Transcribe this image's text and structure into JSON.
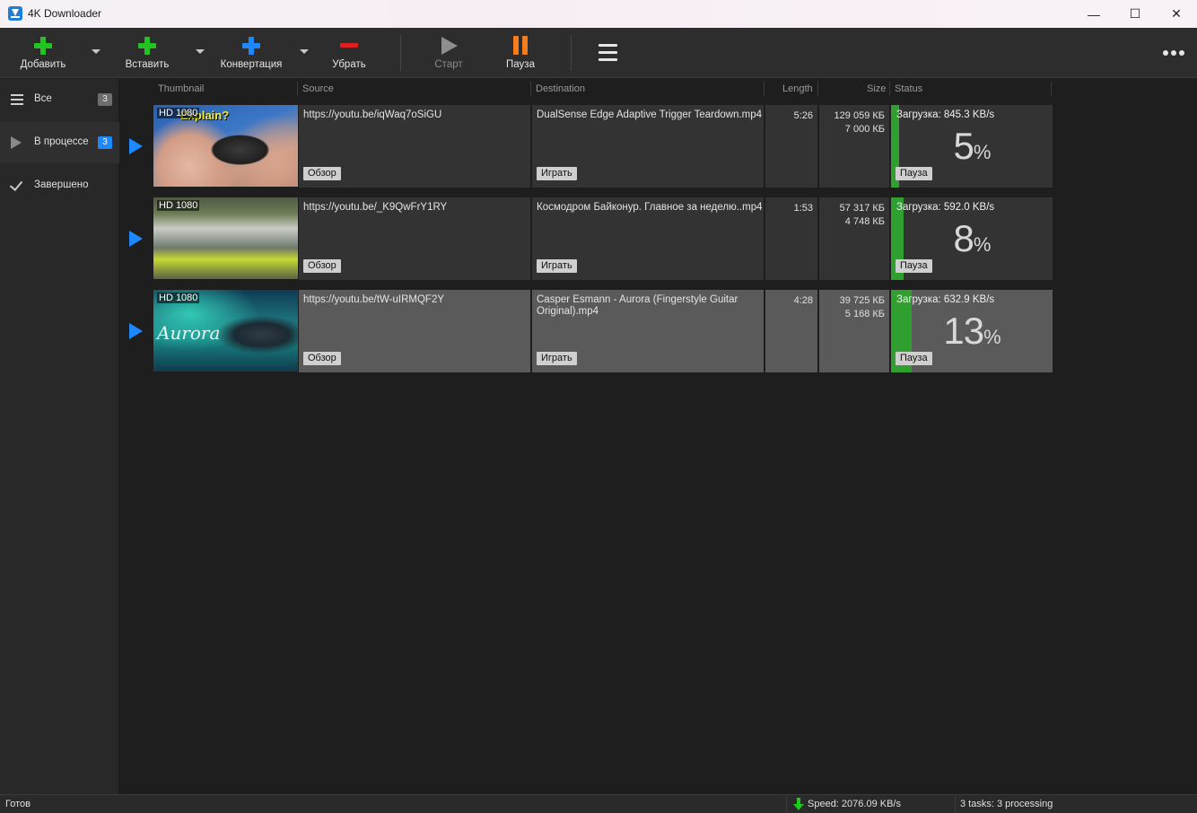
{
  "window": {
    "title": "4K Downloader",
    "minimize_glyph": "—",
    "maximize_glyph": "☐",
    "close_glyph": "✕"
  },
  "toolbar": {
    "add_label": "Добавить",
    "paste_label": "Вставить",
    "convert_label": "Конвертация",
    "remove_label": "Убрать",
    "start_label": "Старт",
    "pause_label": "Пауза",
    "colors": {
      "add": "#22c322",
      "paste": "#22c322",
      "convert": "#1e88ff",
      "remove": "#e02020",
      "pause": "#f57c1f"
    }
  },
  "sidebar": {
    "items": [
      {
        "label": "Все",
        "badge": "3",
        "icon": "list-icon"
      },
      {
        "label": "В процессе",
        "badge": "3",
        "icon": "play-icon"
      },
      {
        "label": "Завершено",
        "badge": "",
        "icon": "check-icon"
      }
    ]
  },
  "columns": {
    "thumbnail": "Thumbnail",
    "source": "Source",
    "destination": "Destination",
    "length": "Length",
    "size": "Size",
    "status": "Status"
  },
  "rows": [
    {
      "quality": "HD 1080",
      "caption": "Explain?",
      "source": "https://youtu.be/iqWaq7oSiGU",
      "browse_label": "Обзор",
      "destination": "DualSense Edge Adaptive Trigger Teardown.mp4",
      "play_label": "Играть",
      "length": "5:26",
      "size_total": "129 059 КБ",
      "size_done": "7 000 КБ",
      "status": "Загрузка: 845.3 KB/s",
      "percent": "5",
      "percent_unit": "%",
      "progress": 0.05,
      "pause_label": "Пауза"
    },
    {
      "quality": "HD 1080",
      "source": "https://youtu.be/_K9QwFrY1RY",
      "browse_label": "Обзор",
      "destination": "Космодром Байконур. Главное за неделю..mp4",
      "play_label": "Играть",
      "length": "1:53",
      "size_total": "57 317 КБ",
      "size_done": "4 748 КБ",
      "status": "Загрузка: 592.0 KB/s",
      "percent": "8",
      "percent_unit": "%",
      "progress": 0.08,
      "pause_label": "Пауза"
    },
    {
      "quality": "HD 1080",
      "caption": "Aurora",
      "source": "https://youtu.be/tW-uIRMQF2Y",
      "browse_label": "Обзор",
      "destination": "Casper Esmann - Aurora (Fingerstyle Guitar Original).mp4",
      "play_label": "Играть",
      "length": "4:28",
      "size_total": "39 725 КБ",
      "size_done": "5 168 КБ",
      "status": "Загрузка: 632.9 KB/s",
      "percent": "13",
      "percent_unit": "%",
      "progress": 0.13,
      "pause_label": "Пауза"
    }
  ],
  "statusbar": {
    "ready": "Готов",
    "speed": "Speed: 2076.09 KB/s",
    "tasks": "3 tasks: 3 processing"
  }
}
